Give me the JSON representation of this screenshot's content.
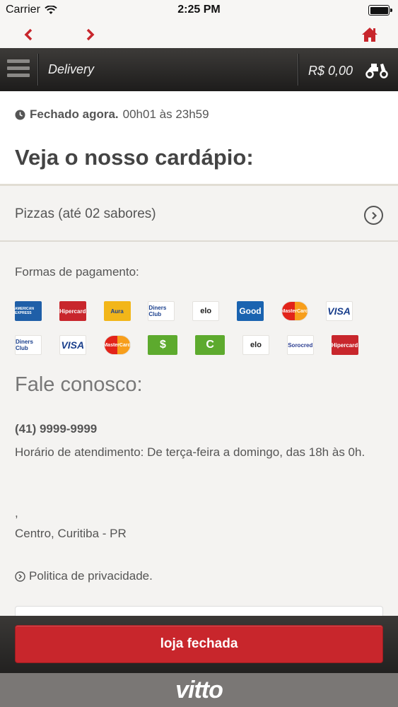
{
  "status_bar": {
    "carrier": "Carrier",
    "time": "2:25 PM"
  },
  "nav": {
    "back_icon": "chevron-left-icon",
    "forward_icon": "chevron-right-icon",
    "home_icon": "home-icon"
  },
  "header": {
    "title": "Delivery",
    "cart_total": "R$ 0,00",
    "cart_icon": "scooter-icon"
  },
  "store_status": {
    "status": "Fechado agora.",
    "hours": "00h01 às 23h59"
  },
  "menu": {
    "title": "Veja o nosso cardápio:",
    "categories": [
      {
        "label": "Pizzas (até 02 sabores)"
      }
    ]
  },
  "payment": {
    "label": "Formas de pagamento:",
    "row1": [
      {
        "name": "AMERICAN EXPRESS",
        "bg": "#1f5fa8",
        "fg": "#ffffff"
      },
      {
        "name": "Hipercard",
        "bg": "#c8262c",
        "fg": "#ffffff"
      },
      {
        "name": "Aura",
        "bg": "#f2b619",
        "fg": "#1a3f8c"
      },
      {
        "name": "Diners Club",
        "bg": "#ffffff",
        "fg": "#1a3f8c"
      },
      {
        "name": "elo",
        "bg": "#ffffff",
        "fg": "#222222"
      },
      {
        "name": "Good",
        "bg": "#1a63b0",
        "fg": "#ffffff"
      },
      {
        "name": "MasterCard",
        "bg": "#ffffff",
        "fg": "#ffffff"
      },
      {
        "name": "VISA",
        "bg": "#ffffff",
        "fg": "#1a3f8c"
      }
    ],
    "row2": [
      {
        "name": "Diners Club",
        "bg": "#ffffff",
        "fg": "#1a3f8c"
      },
      {
        "name": "VISA",
        "bg": "#ffffff",
        "fg": "#1a3f8c"
      },
      {
        "name": "MasterCard",
        "bg": "#ffffff",
        "fg": "#ffffff"
      },
      {
        "name": "$",
        "bg": "#5daa2e",
        "fg": "#ffffff"
      },
      {
        "name": "C",
        "bg": "#5daa2e",
        "fg": "#ffffff"
      },
      {
        "name": "elo",
        "bg": "#ffffff",
        "fg": "#222222"
      },
      {
        "name": "Sorocred",
        "bg": "#ffffff",
        "fg": "#2a3c8f"
      },
      {
        "name": "Hipercard",
        "bg": "#c8262c",
        "fg": "#ffffff"
      }
    ]
  },
  "contact": {
    "title": "Fale conosco:",
    "phone": "(41) 9999-9999",
    "hours": "Horário de atendimento: De terça-feira a domingo, das 18h às 0h.",
    "address_line1": ",",
    "address_line2": "Centro, Curitiba - PR",
    "privacy_link": "Politica de privacidade."
  },
  "footer": {
    "button_label": "loja fechada",
    "brand": "vitto"
  },
  "colors": {
    "accent": "#c8262c",
    "header_dark": "#2a2928",
    "background": "#f4f3f1"
  }
}
